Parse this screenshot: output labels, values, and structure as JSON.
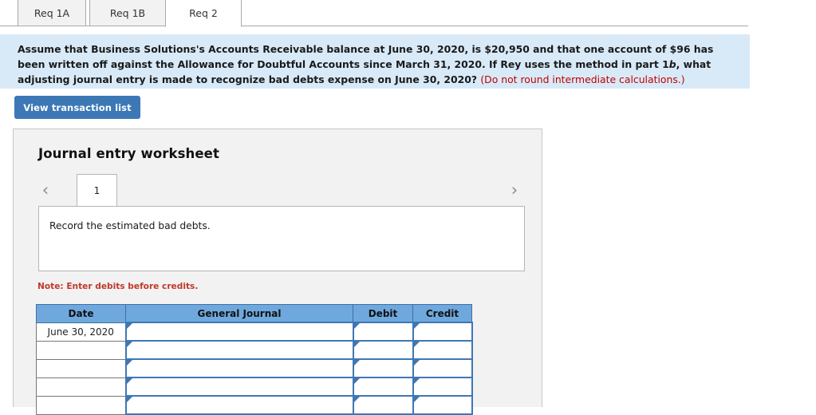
{
  "tabs": [
    {
      "label": "Req 1A",
      "active": false
    },
    {
      "label": "Req 1B",
      "active": false
    },
    {
      "label": "Req 2",
      "active": true
    }
  ],
  "question": {
    "part1": "Assume that Business Solutions's Accounts Receivable balance at June 30, 2020, is $20,950 and that one account of $96 has been written off against the Allowance for Doubtful Accounts since March 31, 2020. If Rey uses the method in part 1",
    "italic": "b",
    "part2": ", what adjusting journal entry is made to recognize bad debts expense on June 30, 2020? ",
    "red_note": "(Do not round intermediate calculations.)"
  },
  "buttons": {
    "view_transaction_list": "View transaction list"
  },
  "worksheet": {
    "title": "Journal entry worksheet",
    "prev_icon": "chevron-left-icon",
    "next_icon": "chevron-right-icon",
    "page_tabs": [
      "1"
    ],
    "instruction": "Record the estimated bad debts.",
    "note": "Note: Enter debits before credits."
  },
  "journal_table": {
    "headers": [
      "Date",
      "General Journal",
      "Debit",
      "Credit"
    ],
    "rows": [
      {
        "date": "June 30, 2020",
        "journal": "",
        "debit": "",
        "credit": ""
      },
      {
        "date": "",
        "journal": "",
        "debit": "",
        "credit": ""
      },
      {
        "date": "",
        "journal": "",
        "debit": "",
        "credit": ""
      },
      {
        "date": "",
        "journal": "",
        "debit": "",
        "credit": ""
      },
      {
        "date": "",
        "journal": "",
        "debit": "",
        "credit": ""
      }
    ]
  },
  "colors": {
    "question_bg": "#d8eaf8",
    "button_blue": "#3c78b5",
    "table_header_blue": "#6fa8dd",
    "note_red": "#c0392b",
    "panel_gray": "#f2f2f2"
  }
}
